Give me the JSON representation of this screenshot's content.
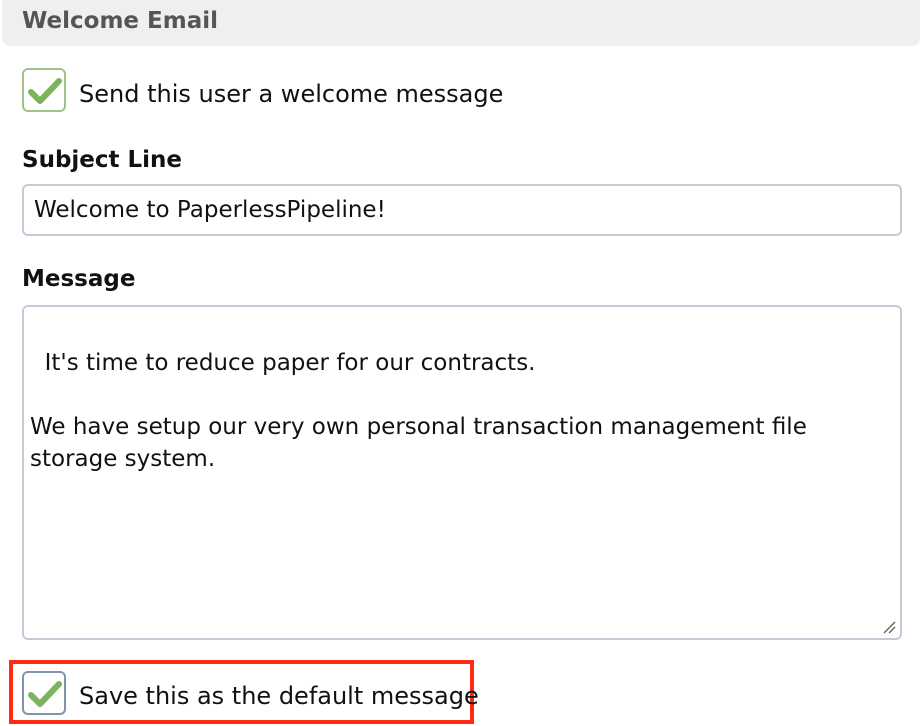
{
  "section": {
    "title": "Welcome Email"
  },
  "send_welcome": {
    "label": "Send this user a welcome message",
    "checked": true,
    "icon": "checkmark-icon"
  },
  "subject": {
    "label": "Subject Line",
    "value": "Welcome to PaperlessPipeline!"
  },
  "message": {
    "label": "Message",
    "value": "It's time to reduce paper for our contracts.\n\nWe have setup our very own personal transaction management file\nstorage system.",
    "resize_icon": "resize-handle-icon"
  },
  "save_default": {
    "label": "Save this as the default message",
    "checked": true,
    "icon": "checkmark-icon"
  },
  "colors": {
    "header_bg": "#efefef",
    "header_text": "#555555",
    "check_green": "#7cb35b",
    "highlight_red": "#ff2a12",
    "input_border": "#c2ccd8"
  }
}
